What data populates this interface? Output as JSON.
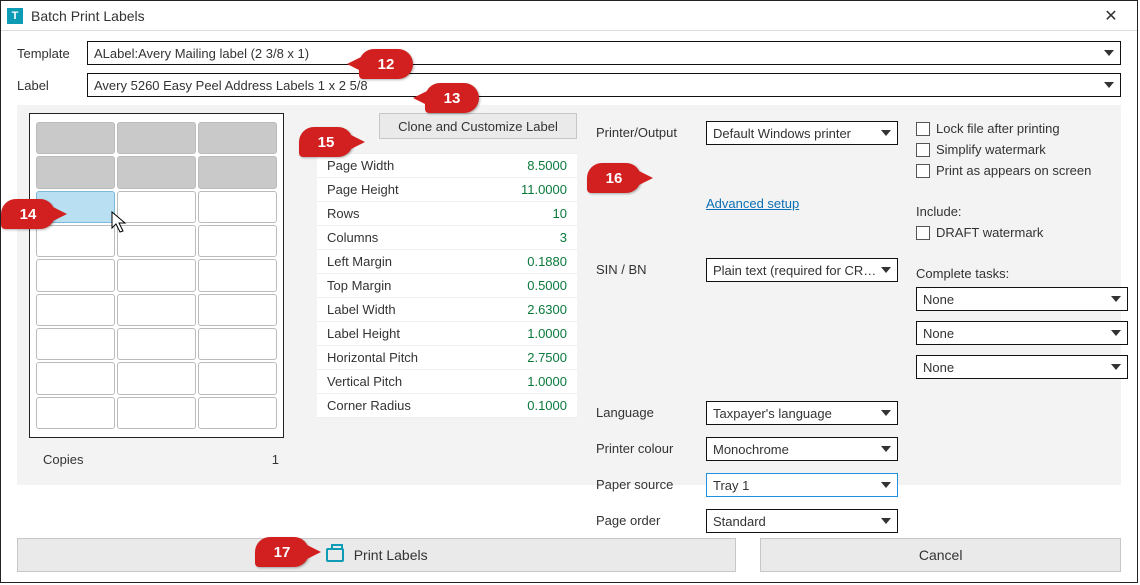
{
  "window": {
    "title": "Batch Print Labels",
    "app_icon_letter": "T"
  },
  "fields": {
    "template_label": "Template",
    "template_value": "ALabel:Avery Mailing label (2 3/8 x 1)",
    "label_label": "Label",
    "label_value": "Avery 5260 Easy Peel Address Labels 1 x 2 5/8"
  },
  "clone_btn": "Clone and Customize Label",
  "specs": [
    {
      "label": "Page Width",
      "value": "8.5000"
    },
    {
      "label": "Page Height",
      "value": "11.0000"
    },
    {
      "label": "Rows",
      "value": "10"
    },
    {
      "label": "Columns",
      "value": "3"
    },
    {
      "label": "Left Margin",
      "value": "0.1880"
    },
    {
      "label": "Top Margin",
      "value": "0.5000"
    },
    {
      "label": "Label Width",
      "value": "2.6300"
    },
    {
      "label": "Label Height",
      "value": "1.0000"
    },
    {
      "label": "Horizontal Pitch",
      "value": "2.7500"
    },
    {
      "label": "Vertical Pitch",
      "value": "1.0000"
    },
    {
      "label": "Corner Radius",
      "value": "0.1000"
    }
  ],
  "copies": {
    "label": "Copies",
    "value": "1"
  },
  "right": {
    "printer_label": "Printer/Output",
    "printer_value": "Default Windows printer",
    "advanced_setup": "Advanced setup",
    "sin_label": "SIN / BN",
    "sin_value": "Plain text (required for CRA co",
    "language_label": "Language",
    "language_value": "Taxpayer's language",
    "colour_label": "Printer colour",
    "colour_value": "Monochrome",
    "paper_label": "Paper source",
    "paper_value": "Tray 1",
    "order_label": "Page order",
    "order_value": "Standard"
  },
  "checks": {
    "lock": "Lock file after printing",
    "simplify": "Simplify watermark",
    "asscreen": "Print as appears on screen",
    "include_head": "Include:",
    "draft": "DRAFT watermark"
  },
  "tasks": {
    "head": "Complete tasks:",
    "v1": "None",
    "v2": "None",
    "v3": "None"
  },
  "footer": {
    "print": "Print Labels",
    "cancel": "Cancel"
  },
  "callouts": {
    "c12": "12",
    "c13": "13",
    "c14": "14",
    "c15": "15",
    "c16": "16",
    "c17": "17"
  }
}
